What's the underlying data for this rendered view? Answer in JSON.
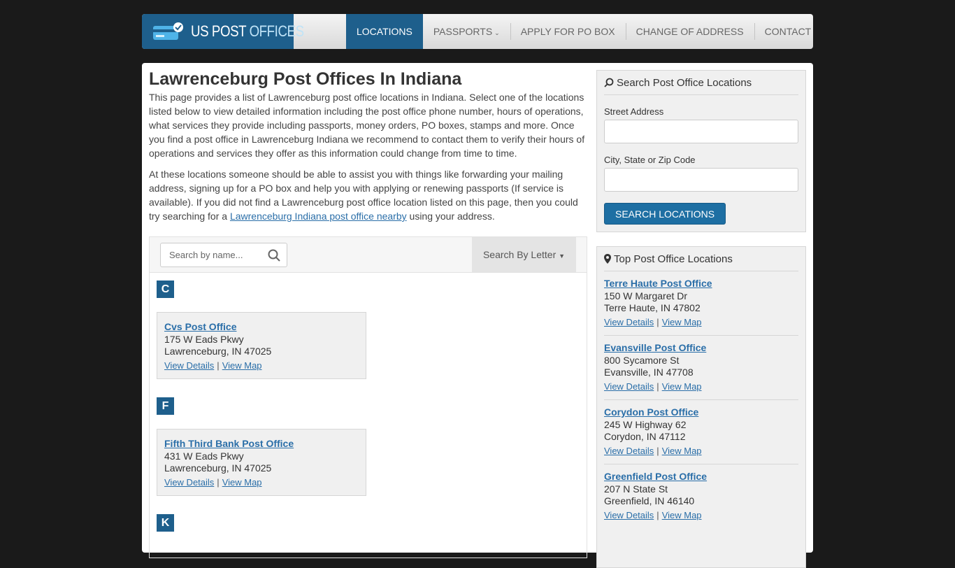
{
  "logo": {
    "part1": "US POST",
    "part2": "OFFICES"
  },
  "nav": {
    "items": [
      {
        "label": "LOCATIONS",
        "active": true
      },
      {
        "label": "PASSPORTS",
        "dropdown": true
      },
      {
        "label": "APPLY FOR PO BOX"
      },
      {
        "label": "CHANGE OF ADDRESS"
      },
      {
        "label": "CONTACT US"
      }
    ]
  },
  "page": {
    "title": "Lawrenceburg Post Offices In Indiana",
    "para1": "This page provides a list of Lawrenceburg post office locations in Indiana. Select one of the locations listed below to view detailed information including the post office phone number, hours of operations, what services they provide including passports, money orders, PO boxes, stamps and more. Once you find a post office in Lawrenceburg Indiana we recommend to contact them to verify their hours of operations and services they offer as this information could change from time to time.",
    "para2_before": "At these locations someone should be able to assist you with things like forwarding your mailing address, signing up for a PO box and help you with applying or renewing passports (If service is available). If you did not find a Lawrenceburg post office location listed on this page, then you could try searching for a ",
    "para2_link": "Lawrenceburg Indiana post office nearby",
    "para2_after": " using your address."
  },
  "listing": {
    "search_placeholder": "Search by name...",
    "letter_button": "Search By Letter",
    "groups": [
      {
        "letter": "C",
        "office": {
          "name": "Cvs Post Office",
          "street": "175 W Eads Pkwy",
          "city": "Lawrenceburg, IN 47025"
        }
      },
      {
        "letter": "F",
        "office": {
          "name": "Fifth Third Bank Post Office",
          "street": "431 W Eads Pkwy",
          "city": "Lawrenceburg, IN 47025"
        }
      },
      {
        "letter": "K"
      }
    ],
    "view_details": "View Details",
    "view_map": "View Map",
    "separator": "|"
  },
  "sidebar": {
    "search": {
      "title": "Search Post Office Locations",
      "street_label": "Street Address",
      "city_label": "City, State or Zip Code",
      "button": "SEARCH LOCATIONS"
    },
    "top": {
      "title": "Top Post Office Locations",
      "items": [
        {
          "name": "Terre Haute Post Office",
          "street": "150 W Margaret Dr",
          "city": "Terre Haute, IN 47802"
        },
        {
          "name": "Evansville Post Office",
          "street": "800 Sycamore St",
          "city": "Evansville, IN 47708"
        },
        {
          "name": "Corydon Post Office",
          "street": "245 W Highway 62",
          "city": "Corydon, IN 47112"
        },
        {
          "name": "Greenfield Post Office",
          "street": "207 N State St",
          "city": "Greenfield, IN 46140"
        }
      ]
    }
  },
  "colors": {
    "brand": "#1e5f8c",
    "link": "#2a6ea8"
  }
}
